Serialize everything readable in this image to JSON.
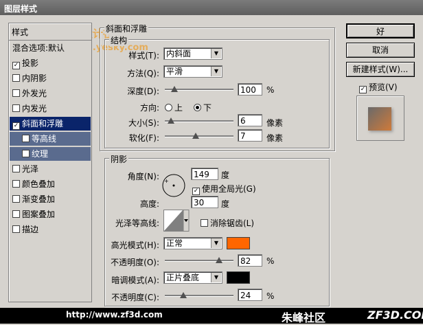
{
  "window": {
    "title": "图层样式"
  },
  "watermark": {
    "line1": "天极设计在线",
    "line2": "design.yesky.com"
  },
  "sidebar": {
    "header": "样式",
    "items": [
      {
        "label": "混合选项:默认",
        "checked": null,
        "state": "normal"
      },
      {
        "label": "投影",
        "checked": true,
        "state": "normal"
      },
      {
        "label": "内阴影",
        "checked": false,
        "state": "normal"
      },
      {
        "label": "外发光",
        "checked": false,
        "state": "normal"
      },
      {
        "label": "内发光",
        "checked": false,
        "state": "normal"
      },
      {
        "label": "斜面和浮雕",
        "checked": true,
        "state": "selected"
      },
      {
        "label": "等高线",
        "checked": false,
        "state": "sub"
      },
      {
        "label": "纹理",
        "checked": false,
        "state": "sub"
      },
      {
        "label": "光泽",
        "checked": false,
        "state": "normal"
      },
      {
        "label": "颜色叠加",
        "checked": false,
        "state": "normal"
      },
      {
        "label": "渐变叠加",
        "checked": false,
        "state": "normal"
      },
      {
        "label": "图案叠加",
        "checked": false,
        "state": "normal"
      },
      {
        "label": "描边",
        "checked": false,
        "state": "normal"
      }
    ]
  },
  "bevel": {
    "title": "斜面和浮雕",
    "structure_title": "结构",
    "style_label": "样式(T):",
    "style_value": "内斜面",
    "method_label": "方法(Q):",
    "method_value": "平滑",
    "depth_label": "深度(D):",
    "depth_value": "100",
    "depth_unit": "%",
    "depth_level": 0.1,
    "direction_label": "方向:",
    "dir_up": "上",
    "dir_down": "下",
    "direction_selected": "下",
    "size_label": "大小(S):",
    "size_value": "6",
    "size_unit": "像素",
    "size_level": 0.04,
    "soften_label": "软化(F):",
    "soften_value": "7",
    "soften_unit": "像素",
    "soften_level": 0.44
  },
  "shading": {
    "title": "阴影",
    "angle_label": "角度(N):",
    "angle_value": "149",
    "angle_unit": "度",
    "global_light_label": "使用全局光(G)",
    "global_light_checked": true,
    "altitude_label": "高度:",
    "altitude_value": "30",
    "altitude_unit": "度",
    "gloss_label": "光泽等高线:",
    "antialias_label": "消除锯齿(L)",
    "antialias_checked": false,
    "highlight_mode_label": "高光模式(H):",
    "highlight_mode_value": "正常",
    "highlight_color": "#ff6600",
    "highlight_opacity_label": "不透明度(O):",
    "highlight_opacity_value": "82",
    "highlight_opacity_unit": "%",
    "highlight_opacity_level": 0.82,
    "shadow_mode_label": "暗调模式(A):",
    "shadow_mode_value": "正片叠底",
    "shadow_color": "#000000",
    "shadow_opacity_label": "不透明度(C):",
    "shadow_opacity_value": "24",
    "shadow_opacity_unit": "%",
    "shadow_opacity_level": 0.24
  },
  "buttons": {
    "ok": "好",
    "cancel": "取消",
    "new_style": "新建样式(W)...",
    "preview": "预览(V)",
    "preview_checked": true
  },
  "footer": {
    "url": "http://www.zf3d.com",
    "brand": "朱峰社区",
    "site": "ZF3D.COM"
  }
}
